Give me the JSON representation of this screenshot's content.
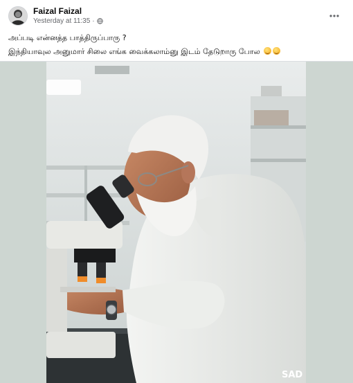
{
  "post": {
    "author_name": "Faizal Faizal",
    "timestamp": "Yesterday at 11:35",
    "separator": "·",
    "privacy_icon": "globe-icon",
    "more_icon": "more-horizontal-icon",
    "caption_line_1": "அப்படி என்னத்த பாத்திருப்பாரு ?",
    "caption_line_2": "இந்தியாவுல அனுமார் சிலை எங்க வைக்கலாம்னு இடம் தேடுறாரு போல",
    "caption_emojis": [
      "grinning-face-emoji",
      "grinning-face-emoji"
    ],
    "watermark": "SAD"
  },
  "colors": {
    "page_bg": "#ffffff",
    "meta_text": "#65676b",
    "divider": "#dadde1",
    "media_letterbox": "#cdd6d1"
  }
}
